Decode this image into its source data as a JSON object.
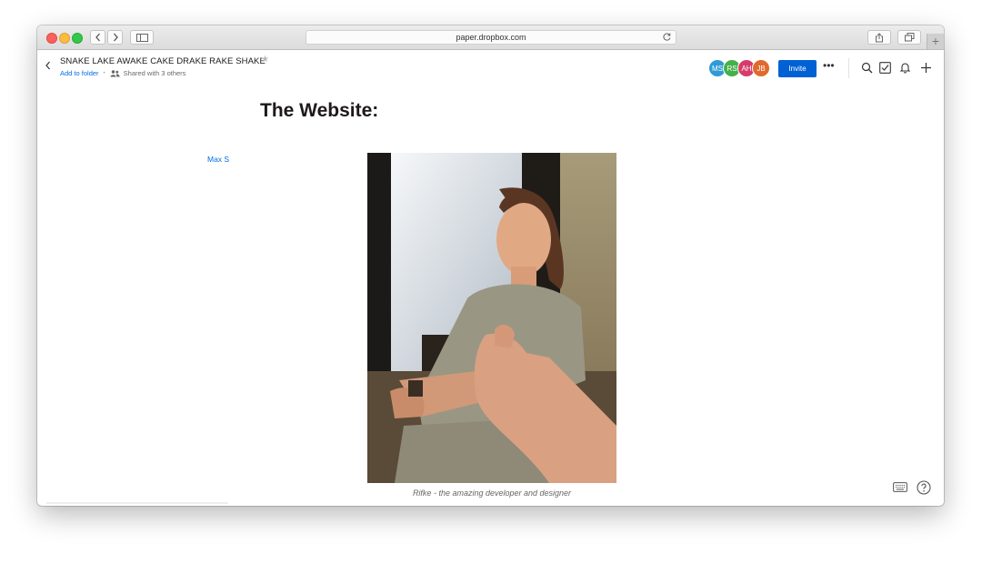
{
  "browser": {
    "url": "paper.dropbox.com"
  },
  "document": {
    "title": "SNAKE LAKE AWAKE CAKE DRAKE RAKE SHAKE",
    "add_to_folder": "Add to folder",
    "separator": "•",
    "shared": "Shared with 3 others",
    "heading": "The Website:",
    "author": "Max S",
    "caption": "Rifke - the amazing developer and designer"
  },
  "collaborators": [
    {
      "initials": "MS",
      "color": "#2e9bd6"
    },
    {
      "initials": "RS",
      "color": "#46b04a"
    },
    {
      "initials": "AH",
      "color": "#d63c6a"
    },
    {
      "initials": "JB",
      "color": "#e06a2c"
    }
  ],
  "toolbar": {
    "invite_label": "Invite",
    "more_label": "•••"
  },
  "icons": [
    "chevron-left-icon",
    "chevron-right-icon",
    "sidebar-icon",
    "reload-icon",
    "share-icon",
    "tabs-icon",
    "back-icon",
    "star-icon",
    "people-icon",
    "search-icon",
    "checkbox-icon",
    "bell-icon",
    "plus-icon",
    "keyboard-icon",
    "help-icon"
  ]
}
